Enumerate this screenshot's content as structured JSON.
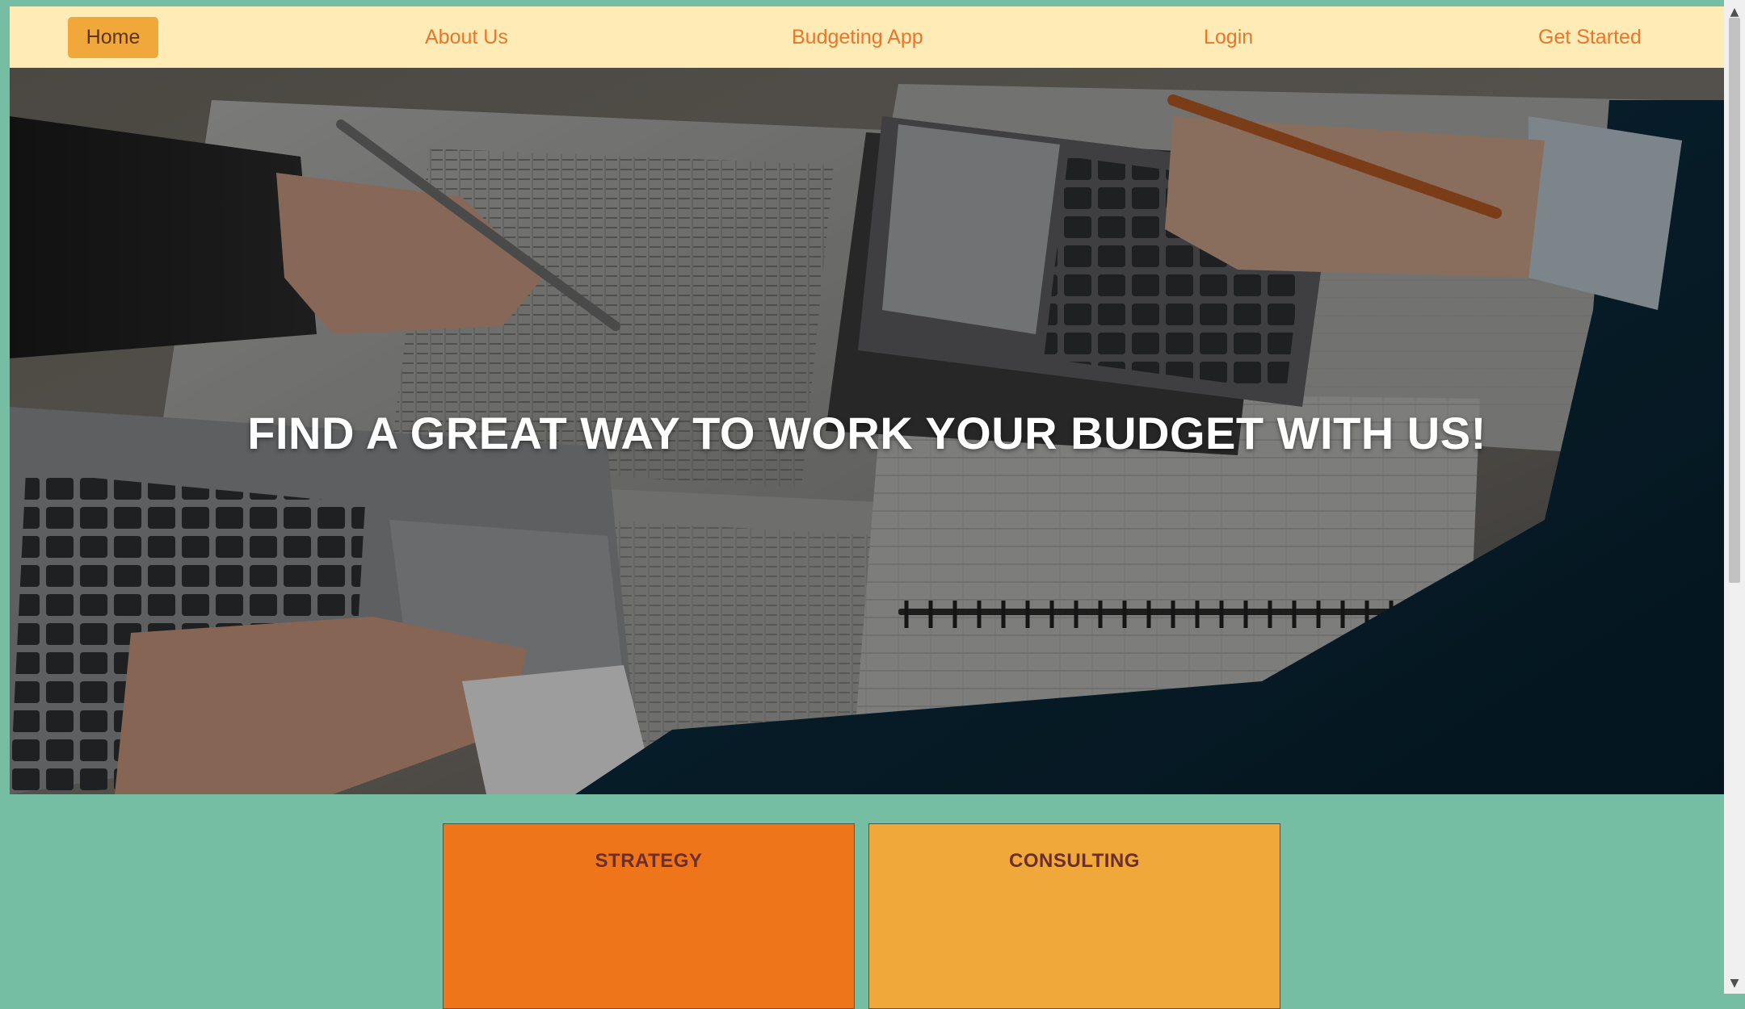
{
  "colors": {
    "page_background": "#75bea3",
    "navbar_background": "#ffebb5",
    "nav_link": "#e9762b",
    "nav_active_background": "#f0a83b",
    "nav_active_text": "#5c3413",
    "card_strategy": "#ef751b",
    "card_consulting": "#f0a83b",
    "card_title": "#6a2e2c",
    "hero_title": "#ffffff"
  },
  "nav": {
    "home": "Home",
    "about": "About Us",
    "budgeting_app": "Budgeting App",
    "login": "Login",
    "get_started": "Get Started"
  },
  "hero": {
    "title": "FIND A GREAT WAY TO WORK YOUR BUDGET WITH US!",
    "image": "business-people-calculator-documents-laptop-photo"
  },
  "cards": [
    {
      "title": "STRATEGY"
    },
    {
      "title": "CONSULTING"
    }
  ],
  "scrollbar": {
    "up_icon": "arrow-up-icon",
    "down_icon": "arrow-down-icon"
  }
}
